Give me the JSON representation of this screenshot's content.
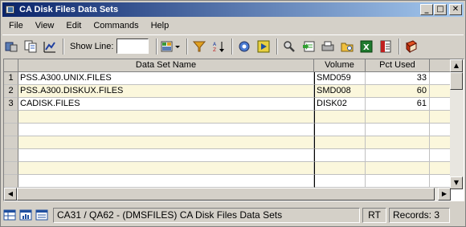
{
  "window": {
    "title": "CA Disk Files Data Sets"
  },
  "menu": [
    "File",
    "View",
    "Edit",
    "Commands",
    "Help"
  ],
  "toolbar": {
    "show_line_label": "Show Line:",
    "show_line_value": ""
  },
  "table": {
    "columns": [
      "Data Set Name",
      "Volume",
      "Pct Used"
    ],
    "rows": [
      {
        "num": "1",
        "name": "PSS.A300.UNIX.FILES",
        "volume": "SMD059",
        "pct": "33"
      },
      {
        "num": "2",
        "name": "PSS.A300.DISKUX.FILES",
        "volume": "SMD008",
        "pct": "60"
      },
      {
        "num": "3",
        "name": "CADISK.FILES",
        "volume": "DISK02",
        "pct": "61"
      }
    ]
  },
  "status": {
    "context": "CA31 / QA62 - (DMSFILES) CA Disk Files Data Sets",
    "mode": "RT",
    "records": "Records: 3"
  },
  "colors": {
    "title_start": "#0a246a",
    "title_end": "#a6caf0",
    "row_highlight": "#fbf7dc",
    "row_normal": "#ffffff"
  }
}
